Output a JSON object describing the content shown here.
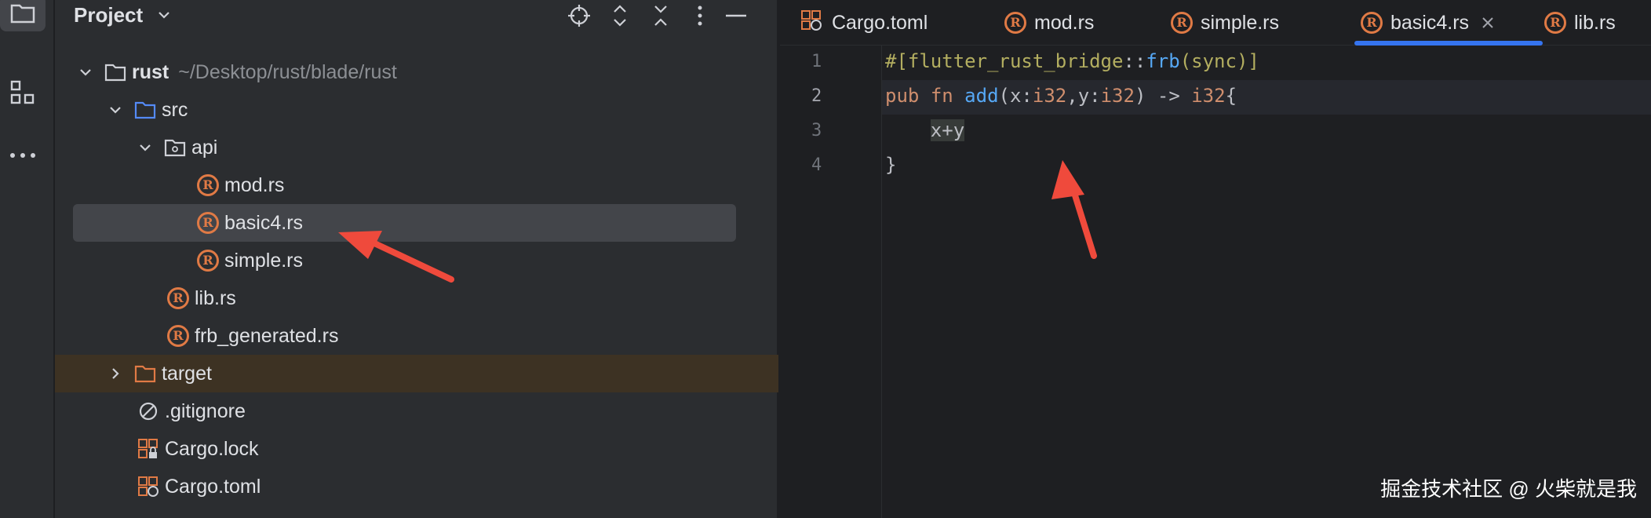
{
  "sidebar_strip": {
    "icons": [
      "folder-icon",
      "structure-icon",
      "more-icon"
    ]
  },
  "project": {
    "title": "Project",
    "header_icons": [
      "locate-icon",
      "expand-collapse-icon",
      "collapse-all-icon",
      "options-icon",
      "hide-icon"
    ],
    "tree": [
      {
        "label": "rust",
        "hint": "~/Desktop/rust/blade/rust",
        "type": "folder",
        "expanded": true
      },
      {
        "label": "src",
        "type": "folder",
        "expanded": true
      },
      {
        "label": "api",
        "type": "package",
        "expanded": true
      },
      {
        "label": "mod.rs",
        "type": "rust-file"
      },
      {
        "label": "basic4.rs",
        "type": "rust-file",
        "selected": true
      },
      {
        "label": "simple.rs",
        "type": "rust-file"
      },
      {
        "label": "lib.rs",
        "type": "rust-file"
      },
      {
        "label": "frb_generated.rs",
        "type": "rust-file"
      },
      {
        "label": "target",
        "type": "folder",
        "expanded": false
      },
      {
        "label": ".gitignore",
        "type": "ignore-file"
      },
      {
        "label": "Cargo.lock",
        "type": "cargo-lock"
      },
      {
        "label": "Cargo.toml",
        "type": "cargo-toml"
      }
    ]
  },
  "editor": {
    "tabs": [
      {
        "label": "Cargo.toml",
        "icon": "cargo-icon"
      },
      {
        "label": "mod.rs",
        "icon": "rust-icon"
      },
      {
        "label": "simple.rs",
        "icon": "rust-icon"
      },
      {
        "label": "basic4.rs",
        "icon": "rust-icon",
        "active": true
      },
      {
        "label": "lib.rs",
        "icon": "rust-icon"
      }
    ],
    "line_numbers": [
      "1",
      "2",
      "3",
      "4"
    ],
    "current_line": 2
  },
  "watermark": "掘金技术社区 @ 火柴就是我",
  "colors": {
    "accent": "#3574f0",
    "rust": "#e07a45",
    "annotation_arrow": "#ef4a3c"
  }
}
